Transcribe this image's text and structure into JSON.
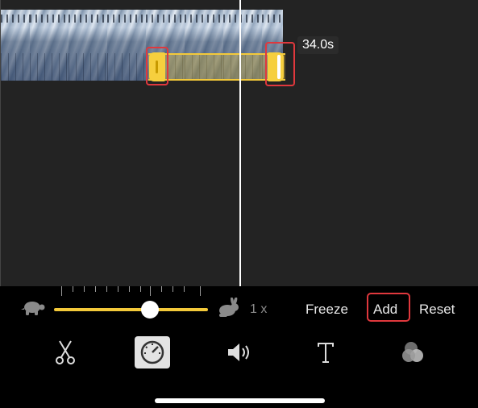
{
  "timeline": {
    "duration_label": "34.0s"
  },
  "speed": {
    "value_label": "1 x",
    "level": 0.6
  },
  "actions": {
    "freeze": "Freeze",
    "add": "Add",
    "reset": "Reset"
  },
  "toolbar": {
    "tools": [
      {
        "icon": "scissors-icon"
      },
      {
        "icon": "speedometer-icon",
        "selected": true
      },
      {
        "icon": "volume-icon"
      },
      {
        "icon": "text-icon",
        "glyph": "T"
      },
      {
        "icon": "filters-icon"
      }
    ]
  },
  "colors": {
    "accent": "#f3c93a",
    "highlight": "#e0383d"
  }
}
